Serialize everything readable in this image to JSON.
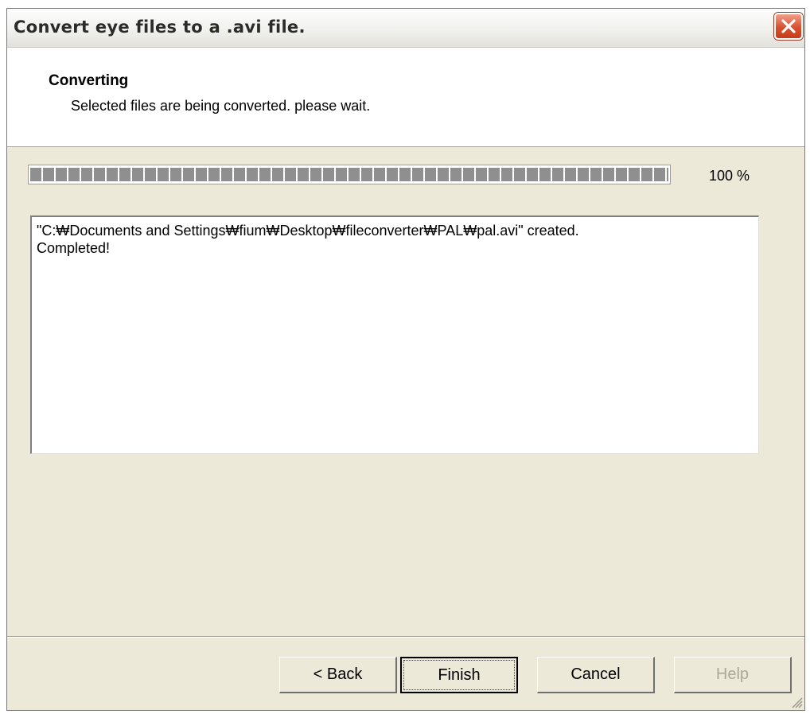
{
  "window": {
    "title": "Convert eye files to a .avi file."
  },
  "header": {
    "title": "Converting",
    "subtitle": "Selected files are being converted. please wait."
  },
  "progress": {
    "value_percent": 100,
    "label": "100 %"
  },
  "log": {
    "lines": [
      "\"C:₩Documents and Settings₩fium₩Desktop₩fileconverter₩PAL₩pal.avi\" created.",
      "Completed!"
    ]
  },
  "buttons": {
    "back": "< Back",
    "finish": "Finish",
    "cancel": "Cancel",
    "help": "Help"
  },
  "icons": {
    "close": "close-icon",
    "grip": "resize-grip-icon"
  },
  "colors": {
    "close_button": "#d8512f",
    "dialog_bg": "#ece9d8",
    "progress_segment": "#8f8f8f"
  }
}
